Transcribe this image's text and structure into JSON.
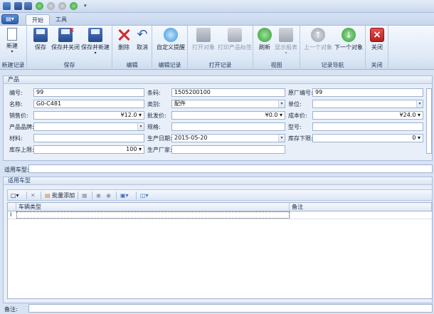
{
  "tabs": [
    {
      "label": "开始",
      "active": true
    },
    {
      "label": "工具",
      "active": false
    }
  ],
  "ribbon": {
    "groups": [
      {
        "label": "新建记录",
        "buttons": [
          {
            "label": "新建",
            "icon": "new-doc-icon"
          }
        ]
      },
      {
        "label": "保存",
        "buttons": [
          {
            "label": "保存",
            "icon": "save-icon"
          },
          {
            "label": "保存并关闭",
            "icon": "save-close-icon"
          },
          {
            "label": "保存并新建",
            "icon": "save-new-icon"
          }
        ]
      },
      {
        "label": "编辑",
        "buttons": [
          {
            "label": "删除",
            "icon": "delete-icon"
          },
          {
            "label": "取消",
            "icon": "undo-icon"
          }
        ]
      },
      {
        "label": "编辑记录",
        "buttons": [
          {
            "label": "自定义提醒",
            "icon": "reminder-icon"
          }
        ]
      },
      {
        "label": "打开记录",
        "buttons": [
          {
            "label": "打开对象",
            "icon": "open-object-icon",
            "disabled": true
          },
          {
            "label": "打印产品标签",
            "icon": "printer-icon",
            "disabled": true
          }
        ]
      },
      {
        "label": "视图",
        "buttons": [
          {
            "label": "刷新",
            "icon": "refresh-icon"
          },
          {
            "label": "显示报表",
            "icon": "report-icon",
            "disabled": true
          }
        ]
      },
      {
        "label": "记录导航",
        "buttons": [
          {
            "label": "上一个对象",
            "icon": "arrow-up-icon",
            "disabled": true
          },
          {
            "label": "下一个对象",
            "icon": "arrow-down-icon"
          }
        ]
      },
      {
        "label": "关闭",
        "buttons": [
          {
            "label": "关闭",
            "icon": "close-icon"
          }
        ]
      }
    ]
  },
  "product": {
    "section_title": "产品",
    "fields": {
      "code": {
        "label": "编号:",
        "value": "99"
      },
      "barcode": {
        "label": "条码:",
        "value": "1505200100"
      },
      "factory_code": {
        "label": "原厂编号:",
        "value": "99"
      },
      "name": {
        "label": "名称:",
        "value": "G0-C481"
      },
      "category": {
        "label": "类别:",
        "value": "配件"
      },
      "unit": {
        "label": "单位:",
        "value": ""
      },
      "sale_price": {
        "label": "销售价:",
        "value": "¥12.0"
      },
      "wholesale_price": {
        "label": "批发价:",
        "value": "¥0.0"
      },
      "cost_price": {
        "label": "成本价:",
        "value": "¥24.0"
      },
      "brand": {
        "label": "产品品牌:",
        "value": ""
      },
      "spec": {
        "label": "规格:",
        "value": ""
      },
      "model": {
        "label": "型号:",
        "value": ""
      },
      "material": {
        "label": "材料:",
        "value": ""
      },
      "production_date": {
        "label": "生产日期:",
        "value": "2015-05-20"
      },
      "stock_min": {
        "label": "库存下限:",
        "value": "0"
      },
      "stock_max": {
        "label": "库存上限:",
        "value": "100"
      },
      "manufacturer": {
        "label": "生产厂家:",
        "value": ""
      }
    }
  },
  "vehicle_type_label": "适用车型:",
  "vehicle_section": {
    "title": "适用车型",
    "toolbar": {
      "batch_add": "批量添加"
    },
    "columns": [
      "车辆类型",
      "备注"
    ]
  },
  "remark_label": "备注:",
  "colors": {
    "accent": "#2c5eb0",
    "panel": "#e8eff9"
  }
}
